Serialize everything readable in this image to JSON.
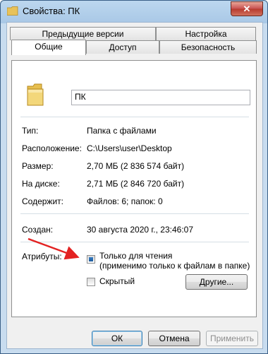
{
  "window": {
    "title": "Свойства: ПК",
    "close_label": "✕"
  },
  "tabs": {
    "row1": [
      {
        "label": "Предыдущие версии"
      },
      {
        "label": "Настройка"
      }
    ],
    "row2": [
      {
        "label": "Общие",
        "active": true
      },
      {
        "label": "Доступ"
      },
      {
        "label": "Безопасность"
      }
    ]
  },
  "general": {
    "folder_name": "ПК",
    "type_label": "Тип:",
    "type_value": "Папка с файлами",
    "location_label": "Расположение:",
    "location_value": "C:\\Users\\user\\Desktop",
    "size_label": "Размер:",
    "size_value": "2,70 МБ (2 836 574 байт)",
    "disk_label": "На диске:",
    "disk_value": "2,71 МБ (2 846 720 байт)",
    "contains_label": "Содержит:",
    "contains_value": "Файлов: 6; папок: 0",
    "created_label": "Создан:",
    "created_value": "30 августа 2020 г., 23:46:07",
    "attributes_label": "Атрибуты:",
    "readonly_label": "Только для чтения",
    "readonly_note": "(применимо только к файлам в папке)",
    "hidden_label": "Скрытый",
    "other_button": "Другие..."
  },
  "footer": {
    "ok": "ОК",
    "cancel": "Отмена",
    "apply": "Применить"
  },
  "colors": {
    "annotation_arrow": "#e32222",
    "title_gradient": "#a9c8e6"
  }
}
